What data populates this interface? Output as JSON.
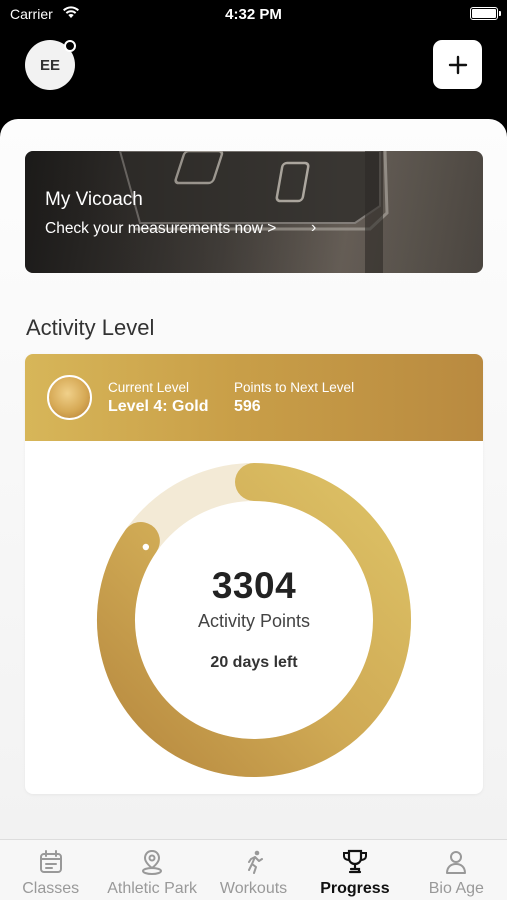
{
  "status_bar": {
    "carrier": "Carrier",
    "time": "4:32 PM"
  },
  "header": {
    "avatar_initials": "EE",
    "add_icon": "plus-icon"
  },
  "vicoach": {
    "title": "My Vicoach",
    "subtitle": "Check your measurements now >",
    "chevron": "›"
  },
  "activity": {
    "section_title": "Activity Level",
    "current_level_caption": "Current Level",
    "current_level_value": "Level 4: Gold",
    "next_level_caption": "Points to Next Level",
    "next_level_value": "596",
    "points": "3304",
    "points_label": "Activity Points",
    "days_left": "20 days left",
    "progress_fraction": 0.847,
    "colors": {
      "gold_light": "#d9bb5e",
      "gold_dark": "#b8893f",
      "track": "#f3ead6"
    }
  },
  "tabs": [
    {
      "label": "Classes",
      "icon": "calendar-icon",
      "active": false
    },
    {
      "label": "Athletic Park",
      "icon": "location-pin-icon",
      "active": false
    },
    {
      "label": "Workouts",
      "icon": "runner-icon",
      "active": false
    },
    {
      "label": "Progress",
      "icon": "trophy-icon",
      "active": true
    },
    {
      "label": "Bio Age",
      "icon": "person-icon",
      "active": false
    }
  ]
}
